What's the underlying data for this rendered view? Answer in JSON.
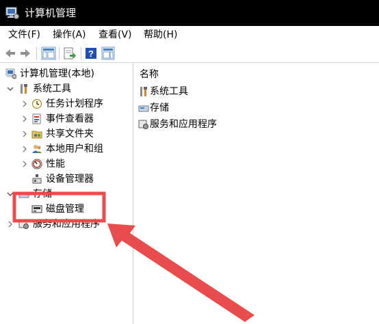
{
  "window": {
    "title": "计算机管理"
  },
  "menu": [
    {
      "label": "文件(F)"
    },
    {
      "label": "操作(A)"
    },
    {
      "label": "查看(V)"
    },
    {
      "label": "帮助(H)"
    }
  ],
  "toolbar": {
    "back": "back-arrow-icon",
    "forward": "forward-arrow-icon",
    "show_hide_tree": "console-tree-icon",
    "export_list": "export-list-icon",
    "help": "help-icon",
    "properties": "properties-pane-icon"
  },
  "tree": {
    "root": {
      "label": "计算机管理(本地)",
      "icon": "computer-management-icon"
    },
    "system_tools": {
      "label": "系统工具",
      "expanded": true,
      "children": [
        {
          "label": "任务计划程序",
          "icon": "clock-icon"
        },
        {
          "label": "事件查看器",
          "icon": "event-viewer-icon"
        },
        {
          "label": "共享文件夹",
          "icon": "shared-folder-icon"
        },
        {
          "label": "本地用户和组",
          "icon": "users-icon"
        },
        {
          "label": "性能",
          "icon": "performance-icon"
        },
        {
          "label": "设备管理器",
          "icon": "device-manager-icon"
        }
      ]
    },
    "storage": {
      "label": "存储",
      "expanded": true,
      "children": [
        {
          "label": "磁盘管理",
          "icon": "disk-management-icon"
        }
      ]
    },
    "services": {
      "label": "服务和应用程序",
      "icon": "services-icon"
    }
  },
  "list": {
    "column_header": "名称",
    "items": [
      {
        "label": "系统工具",
        "icon": "tools-icon"
      },
      {
        "label": "存储",
        "icon": "storage-icon"
      },
      {
        "label": "服务和应用程序",
        "icon": "services-icon"
      }
    ]
  },
  "colors": {
    "highlight": "#e84c4c",
    "titlebar": "#000000"
  }
}
